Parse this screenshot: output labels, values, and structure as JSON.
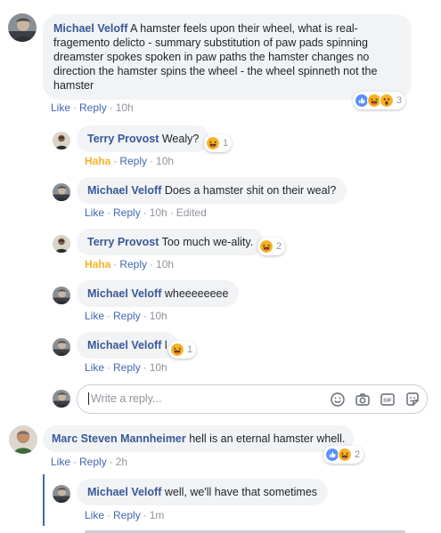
{
  "comments": [
    {
      "author": "Michael Veloff",
      "text": "A hamster feels upon their wheel, what is real-fragemento delicto - summary substitution of paw pads spinning dreamster spokes spoken in paw paths the hamster changes no direction the hamster spins the wheel - the wheel spinneth not the hamster",
      "like": "Like",
      "reply": "Reply",
      "time": "10h",
      "reactions": [
        "like",
        "haha",
        "wow"
      ],
      "reaction_count": "3"
    },
    {
      "author": "Terry Provost",
      "text": "Wealy?",
      "like": "Haha",
      "reply": "Reply",
      "time": "10h",
      "reactions": [
        "haha"
      ],
      "reaction_count": "1"
    },
    {
      "author": "Michael Veloff",
      "text": "Does a hamster shit on their weal?",
      "like": "Like",
      "reply": "Reply",
      "time": "10h",
      "edited": "Edited"
    },
    {
      "author": "Terry Provost",
      "text": "Too much we-ality.",
      "like": "Haha",
      "reply": "Reply",
      "time": "10h",
      "reactions": [
        "haha"
      ],
      "reaction_count": "2"
    },
    {
      "author": "Michael Veloff",
      "text": "wheeeeeeee",
      "like": "Like",
      "reply": "Reply",
      "time": "10h"
    },
    {
      "author": "Michael Veloff",
      "text": "l",
      "like": "Like",
      "reply": "Reply",
      "time": "10h",
      "reactions": [
        "haha"
      ],
      "reaction_count": "1"
    },
    {
      "author": "Marc Steven Mannheimer",
      "text": "hell is an eternal hamster whell.",
      "like": "Like",
      "reply": "Reply",
      "time": "2h",
      "reactions": [
        "like",
        "haha"
      ],
      "reaction_count": "2"
    },
    {
      "author": "Michael Veloff",
      "text": "well, we'll have that sometimes",
      "like": "Like",
      "reply": "Reply",
      "time": "1m"
    }
  ],
  "reply_box": {
    "placeholder": "Write a reply...",
    "icons": [
      "emoji-icon",
      "camera-icon",
      "gif-icon",
      "sticker-icon"
    ]
  },
  "colors": {
    "name": "#385898",
    "link": "#4267b2",
    "haha": "#f7b125",
    "meta": "#90949c",
    "bubble": "#f2f3f5",
    "like_reaction": "#5890ff"
  }
}
